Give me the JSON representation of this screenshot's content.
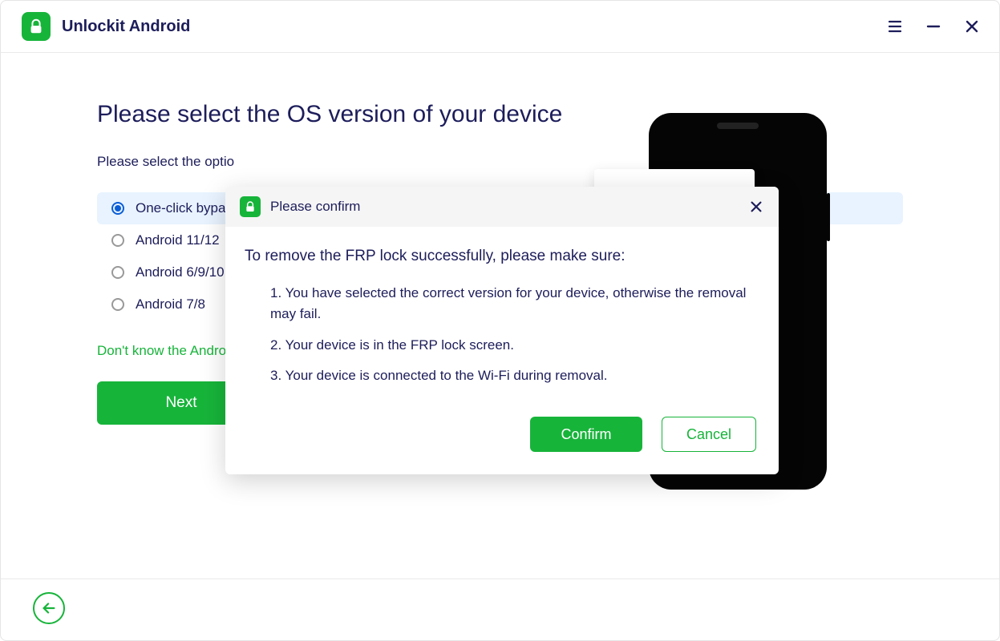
{
  "header": {
    "app_name": "Unlockit Android"
  },
  "main": {
    "title": "Please select the OS version of your device",
    "subtitle_visible": "Please select the optio",
    "options": [
      {
        "label_visible": "One-click bypass",
        "selected": true
      },
      {
        "label_visible": "Android 11/12",
        "selected": false
      },
      {
        "label_visible": "Android 6/9/10",
        "selected": false
      },
      {
        "label_visible": "Android 7/8",
        "selected": false
      }
    ],
    "help_link_visible": "Don't know the Andro",
    "next_label": "Next"
  },
  "modal": {
    "title": "Please confirm",
    "lead": "To remove the FRP lock successfully, please make sure:",
    "items": [
      "1. You have selected the correct version for your device, otherwise the removal may fail.",
      "2. Your device is in the FRP lock screen.",
      "3. Your device is connected to the Wi-Fi during removal."
    ],
    "confirm_label": "Confirm",
    "cancel_label": "Cancel"
  }
}
